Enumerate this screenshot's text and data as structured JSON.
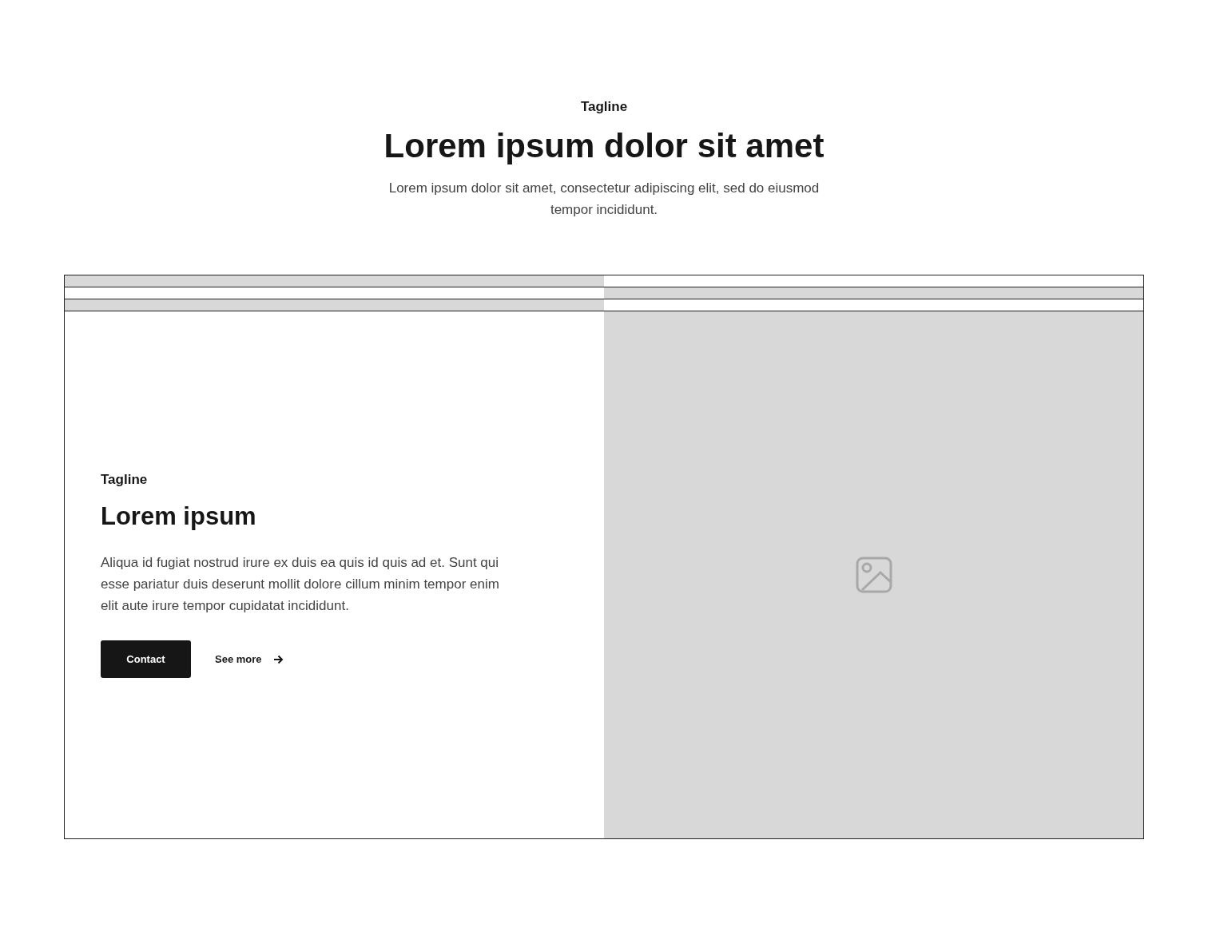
{
  "header": {
    "tagline": "Tagline",
    "title": "Lorem ipsum dolor sit amet",
    "subtitle": "Lorem ipsum dolor sit amet, consectetur adipiscing elit, sed do eiusmod tempor incididunt."
  },
  "collapsed_rows": [
    {
      "image_on_right": false
    },
    {
      "image_on_right": true
    },
    {
      "image_on_right": false
    }
  ],
  "feature": {
    "image_on_right": true,
    "tagline": "Tagline",
    "title": "Lorem ipsum",
    "body": "Aliqua id fugiat nostrud irure ex duis ea quis id quis ad et. Sunt qui esse pariatur duis deserunt mollit dolore cillum minim tempor enim elit aute irure tempor cupidatat incididunt.",
    "primary_button": "Contact",
    "link": "See more"
  }
}
